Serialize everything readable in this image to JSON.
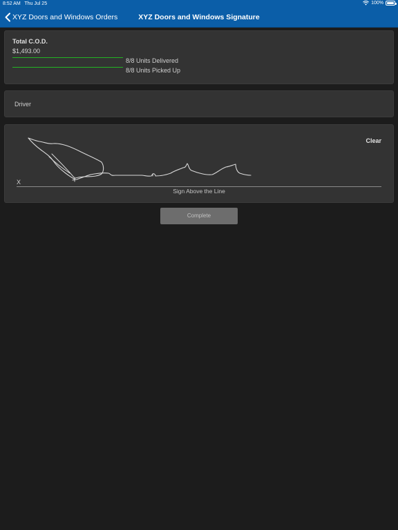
{
  "status_bar": {
    "time": "8:52 AM",
    "date": "Thu Jul 25",
    "battery": "100%",
    "wifi_icon": "wifi-icon",
    "battery_icon": "battery-icon"
  },
  "nav": {
    "back_label": "XYZ Doors and Windows Orders",
    "title": "XYZ Doors and Windows Signature",
    "back_icon": "chevron-left-icon"
  },
  "summary": {
    "cod_label": "Total C.O.D.",
    "cod_value": "$1,493.00",
    "delivered_label": "8/8 Units Delivered",
    "delivered_fraction": 1.0,
    "picked_up_label": "8/8 Units Picked Up",
    "picked_up_fraction": 1.0
  },
  "driver": {
    "placeholder": "Driver",
    "value": ""
  },
  "signature": {
    "clear_label": "Clear",
    "x_label": "X",
    "caption": "Sign Above the Line"
  },
  "actions": {
    "complete_label": "Complete"
  },
  "colors": {
    "nav_bar": "#0b5ea8",
    "background": "#1c1c1c",
    "card": "#333333",
    "progress": "#23b523",
    "complete_button": "#6d6d6d"
  }
}
